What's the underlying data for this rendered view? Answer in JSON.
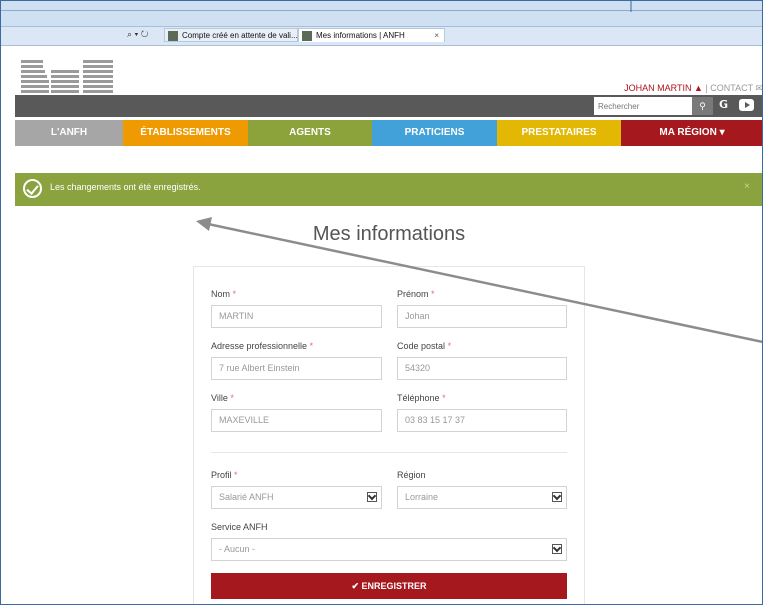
{
  "browser": {
    "address_controls": "⌕ ▾ ↻",
    "tabs": [
      {
        "label": "Compte créé en attente de vali..."
      },
      {
        "label": "Mes informations | ANFH",
        "close": "×"
      }
    ]
  },
  "header": {
    "user_name": "JOHAN MARTIN",
    "separator": "|",
    "contact": "CONTACT",
    "search_placeholder": "Rechercher"
  },
  "nav": [
    {
      "label": "L'ANFH",
      "color": "#a6a6a6"
    },
    {
      "label": "ÉTABLISSEMENTS",
      "color": "#ee9a00"
    },
    {
      "label": "AGENTS",
      "color": "#8ca33c"
    },
    {
      "label": "PRATICIENS",
      "color": "#41a1d8"
    },
    {
      "label": "PRESTATAIRES",
      "color": "#e3b805"
    },
    {
      "label": "MA RÉGION  ▾",
      "color": "#a4181e"
    }
  ],
  "alert": {
    "message": "Les changements ont été enregistrés.",
    "close": "×"
  },
  "page_title": "Mes informations",
  "form": {
    "nom": {
      "label": "Nom",
      "value": "MARTIN"
    },
    "prenom": {
      "label": "Prénom",
      "value": "Johan"
    },
    "adresse": {
      "label": "Adresse professionnelle",
      "value": "7 rue Albert Einstein"
    },
    "code_postal": {
      "label": "Code postal",
      "value": "54320"
    },
    "ville": {
      "label": "Ville",
      "value": "MAXEVILLE"
    },
    "telephone": {
      "label": "Téléphone",
      "value": "03 83 15 17 37"
    },
    "profil": {
      "label": "Profil",
      "value": "Salarié ANFH"
    },
    "region": {
      "label": "Région",
      "value": "Lorraine"
    },
    "service": {
      "label": "Service ANFH",
      "value": "- Aucun -"
    },
    "required_mark": "*",
    "submit_label": "✔ ENREGISTRER"
  }
}
